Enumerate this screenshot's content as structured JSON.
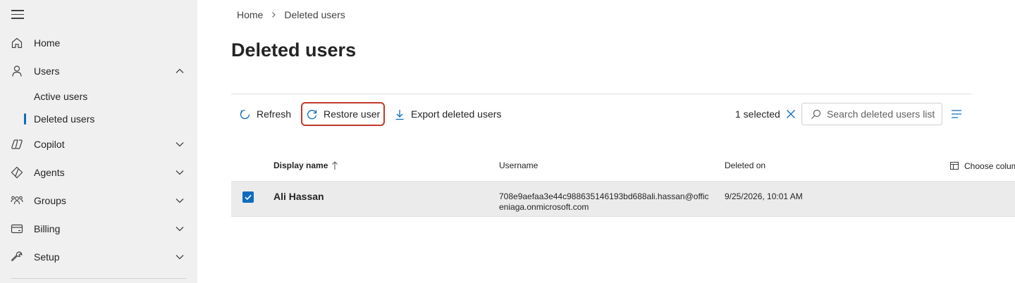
{
  "sidebar": {
    "items": [
      {
        "label": "Home",
        "icon": "home-icon"
      },
      {
        "label": "Users",
        "icon": "user-icon",
        "expanded": true,
        "children": [
          {
            "label": "Active users"
          },
          {
            "label": "Deleted users",
            "active": true
          }
        ]
      },
      {
        "label": "Copilot",
        "icon": "copilot-icon"
      },
      {
        "label": "Agents",
        "icon": "agents-icon"
      },
      {
        "label": "Groups",
        "icon": "groups-icon"
      },
      {
        "label": "Billing",
        "icon": "billing-icon"
      },
      {
        "label": "Setup",
        "icon": "wrench-icon"
      }
    ]
  },
  "breadcrumb": {
    "home": "Home",
    "current": "Deleted users"
  },
  "page": {
    "title": "Deleted users"
  },
  "toolbar": {
    "refresh_label": "Refresh",
    "restore_label": "Restore user",
    "export_label": "Export deleted users",
    "selected_text": "1 selected",
    "search_placeholder": "Search deleted users list"
  },
  "table": {
    "columns": {
      "display_name": "Display name",
      "username": "Username",
      "deleted_on": "Deleted on",
      "choose_columns": "Choose colum"
    },
    "sort": "ascending",
    "rows": [
      {
        "selected": true,
        "display_name": "Ali Hassan",
        "username": "708e9aefaa3e44c988635146193bd688ali.hassan@officeniaga.onmicrosoft.com",
        "deleted_on": "9/25/2026, 10:01 AM"
      }
    ]
  },
  "colors": {
    "accent": "#0f6cbd",
    "sidebar_bg": "#f0f0f0",
    "highlight": "#c0392b",
    "row_selected": "#ebebeb"
  }
}
